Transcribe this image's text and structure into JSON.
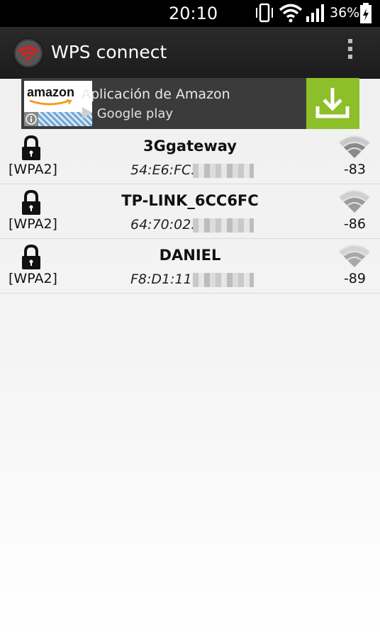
{
  "status": {
    "time": "20:10",
    "battery": "36%"
  },
  "app": {
    "title": "WPS connect"
  },
  "ad": {
    "brand": "amazon",
    "title": "Aplicación de Amazon",
    "store": "Google play",
    "install_color": "#8cbf2a"
  },
  "networks": [
    {
      "ssid": "3Ggateway",
      "security": "[WPA2]",
      "mac": "54:E6:FC:",
      "rssi": "-83"
    },
    {
      "ssid": "TP-LINK_6CC6FC",
      "security": "[WPA2]",
      "mac": "64:70:02:",
      "rssi": "-86"
    },
    {
      "ssid": "DANIEL",
      "security": "[WPA2]",
      "mac": "F8:D1:11:",
      "rssi": "-89"
    }
  ]
}
